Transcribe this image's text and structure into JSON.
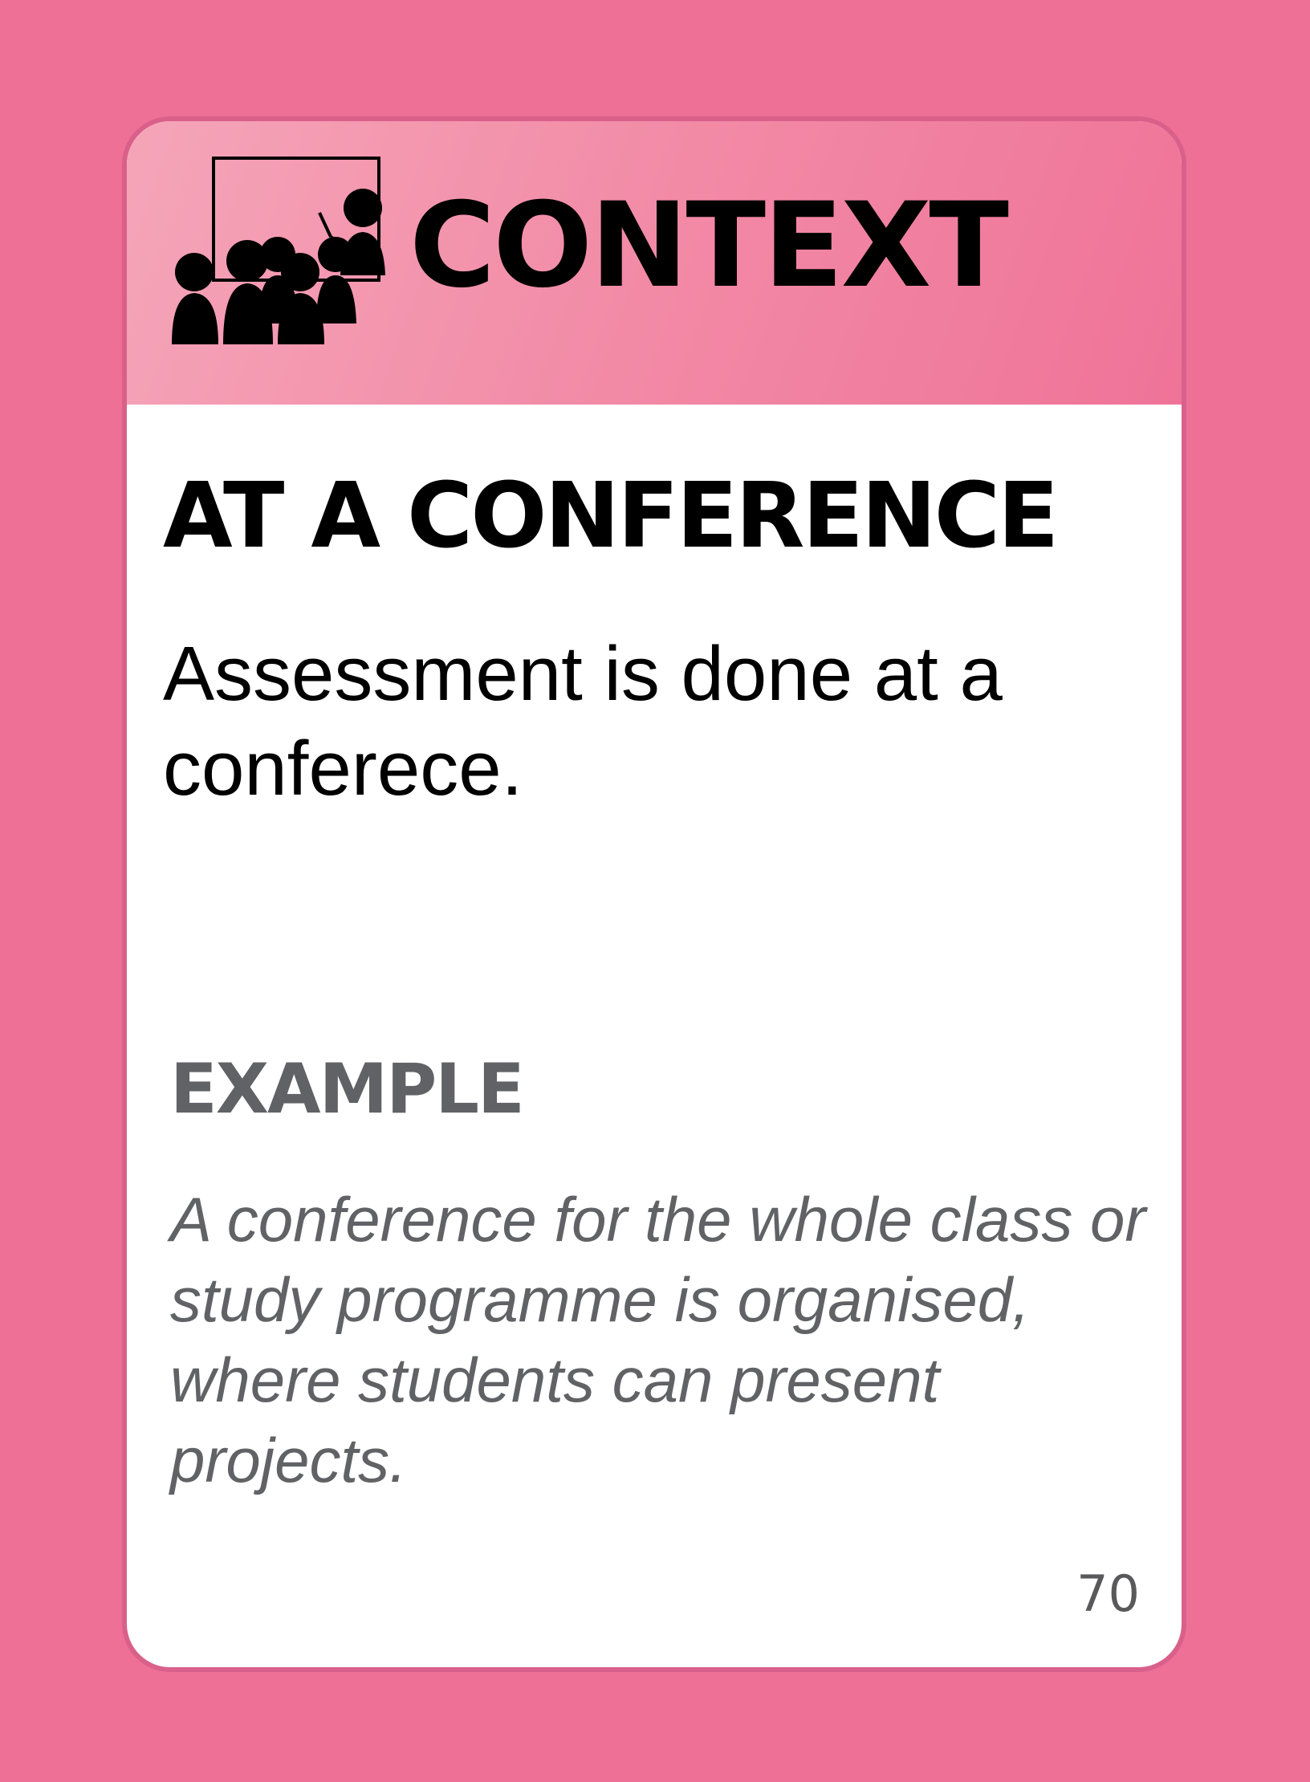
{
  "header": {
    "category": "CONTEXT",
    "icon": "conference-presenter-audience-icon"
  },
  "card": {
    "title": "AT A CONFERENCE",
    "description": "Assessment is done at a conferece.",
    "example_heading": "EXAMPLE",
    "example_text": "A conference for the whole class or study programme is organised, where students can present projects.",
    "page_number": "70"
  },
  "colors": {
    "background": "#ef7096",
    "header_gradient_start": "#f5a5b9",
    "header_gradient_end": "#ef7398",
    "card_border": "#d9608a",
    "example_text": "#616266"
  }
}
